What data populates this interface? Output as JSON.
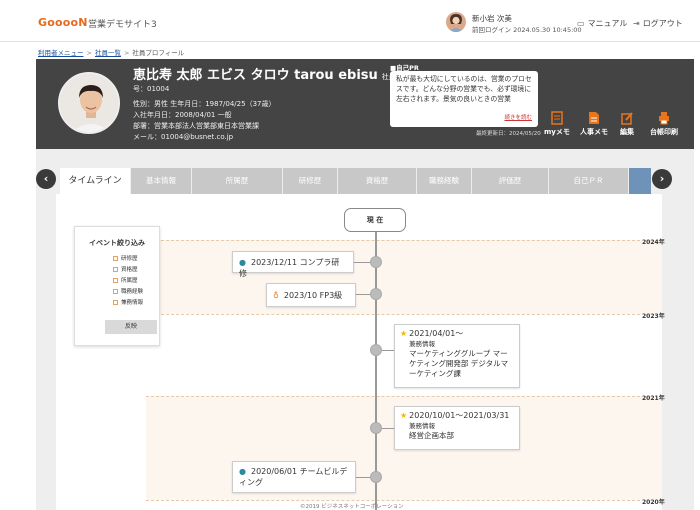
{
  "header": {
    "logo": "GooooN",
    "site_title": "営業デモサイト3",
    "user_name": "新小岩 次美",
    "last_login": "前回ログイン 2024.05.30 10:45:00",
    "manual_label": "マニュアル",
    "logout_label": "ログアウト"
  },
  "breadcrumb": {
    "items": [
      "利用者メニュー",
      "社員一覧"
    ],
    "current": "社員プロフィール",
    "sep": ">"
  },
  "profile": {
    "name": "恵比寿 太郎 エビス タロウ tarou ebisu",
    "role": "社員番",
    "employee_no": "号：01004",
    "gender_birth": "性別：男性 生年月日：1987/04/25（37歳）",
    "joined": "入社年月日：2008/04/01 一般",
    "dept": "部署：営業本部法人営業部東日本営業課",
    "email": "メール：01004@busnet.co.jp",
    "pr_label": "■自己PR",
    "pr_text": "私が最も大切にしているのは、営業のプロセスです。どんな分野の営業でも、必ず環境に左右されます。景気の良いときの営業",
    "pr_more": "続きを読む",
    "pr_updated": "最終更新日：2024/05/20",
    "actions": {
      "mymemo": "myメモ",
      "hrmemo": "人事メモ",
      "edit": "編集",
      "print": "台帳印刷"
    }
  },
  "tabs": [
    {
      "label": "タイムライン"
    },
    {
      "label": "基本情報"
    },
    {
      "label": "所属歴"
    },
    {
      "label": "研修歴"
    },
    {
      "label": "資格歴"
    },
    {
      "label": "職務経験"
    },
    {
      "label": "評価歴"
    },
    {
      "label": "自己ＰＲ"
    }
  ],
  "nav": {
    "prev": "‹",
    "next": "›"
  },
  "filter": {
    "title": "イベント絞り込み",
    "options": [
      "研修歴",
      "資格歴",
      "所属歴",
      "職務経験",
      "兼務情報"
    ],
    "button": "反映"
  },
  "timeline": {
    "now_label": "現 在",
    "years": [
      "2024年",
      "2023年",
      "2021年",
      "2020年"
    ],
    "events": [
      {
        "title": "2023/12/11 コンプラ研修"
      },
      {
        "title": "2023/10 FP3級"
      },
      {
        "date": "2021/04/01～",
        "type": "兼務情報",
        "detail": "マーケティンググループ マーケティング開発部 デジタルマーケティング課"
      },
      {
        "date": "2020/10/01～2021/03/31",
        "type": "兼務情報",
        "detail": "経営企画本部"
      },
      {
        "title": "2020/06/01 チームビルディング"
      }
    ]
  },
  "footer": "©2019 ビジネスネットコーポレーション"
}
